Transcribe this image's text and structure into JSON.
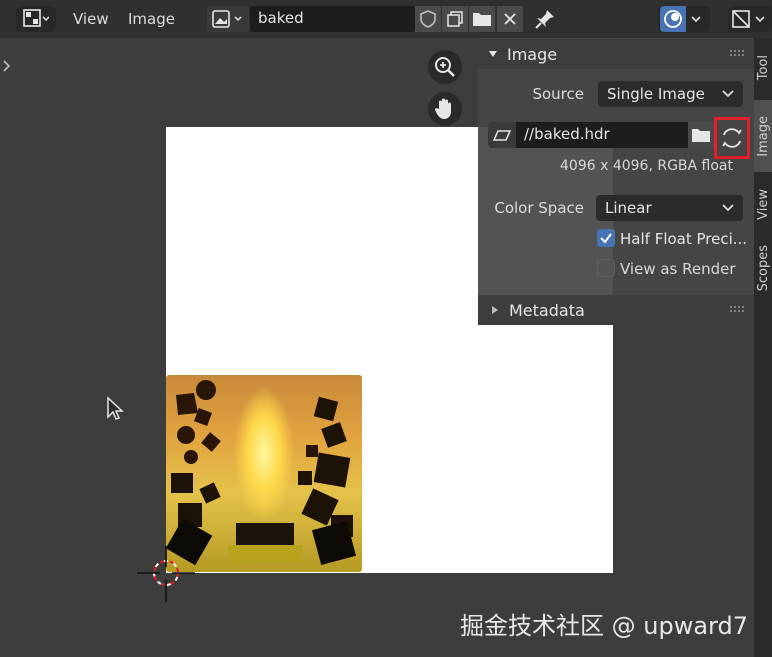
{
  "header": {
    "menu": [
      "View",
      "Image"
    ],
    "image_name": "baked",
    "icons": [
      "image-editor-icon",
      "image-browse-icon",
      "fake-user-shield-icon",
      "duplicate-icon",
      "folder-icon",
      "close-icon",
      "pin-icon",
      "overlay-icon",
      "display-channels-icon"
    ]
  },
  "viewport": {
    "tools": [
      "zoom-icon",
      "hand-pan-icon"
    ]
  },
  "image_panel": {
    "title": "Image",
    "source_label": "Source",
    "source_value": "Single Image",
    "filepath": "//baked.hdr",
    "info": "4096 x 4096,  RGBA float",
    "color_space_label": "Color Space",
    "color_space_value": "Linear",
    "half_float_label": "Half Float Preci...",
    "half_float_checked": true,
    "view_as_render_label": "View as Render",
    "view_as_render_checked": false,
    "metadata_title": "Metadata"
  },
  "tabs": [
    "Tool",
    "Image",
    "View",
    "Scopes"
  ],
  "watermark": "掘金技术社区 @ upward7",
  "colors": {
    "accent_blue": "#4772b3",
    "highlight_red": "#e0202a"
  }
}
